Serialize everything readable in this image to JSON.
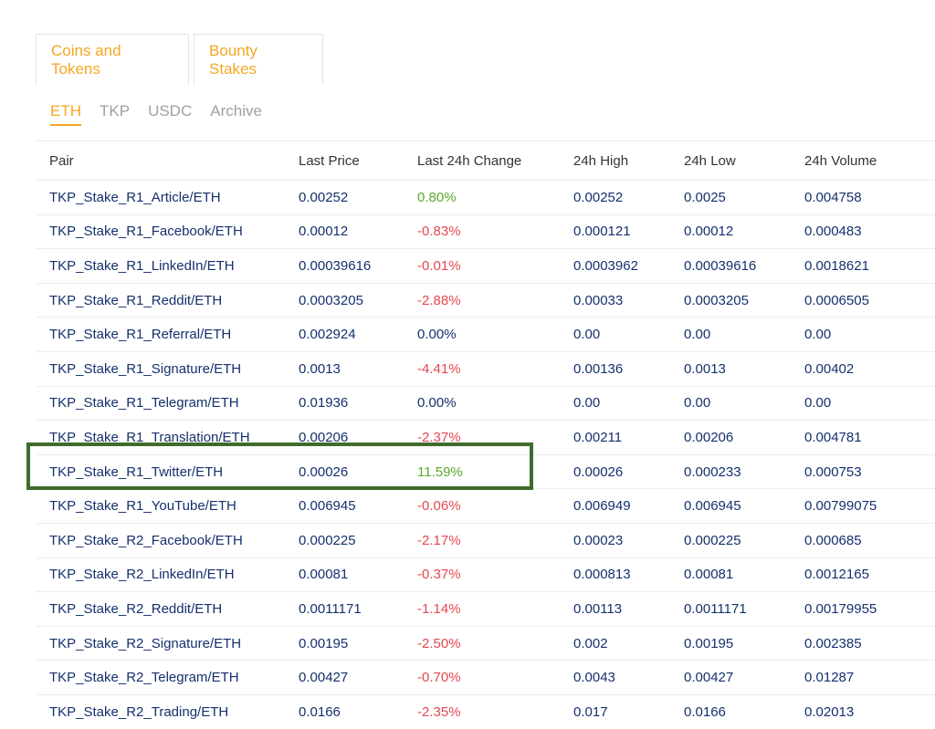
{
  "tabs": [
    "Coins and Tokens",
    "Bounty Stakes"
  ],
  "subtabs": [
    "ETH",
    "TKP",
    "USDC",
    "Archive"
  ],
  "table": {
    "headers": [
      "Pair",
      "Last Price",
      "Last 24h Change",
      "24h High",
      "24h Low",
      "24h Volume"
    ],
    "rows": [
      [
        "TKP_Stake_R1_Article/ETH",
        "0.00252",
        "0.80%",
        "0.00252",
        "0.0025",
        "0.004758"
      ],
      [
        "TKP_Stake_R1_Facebook/ETH",
        "0.00012",
        "-0.83%",
        "0.000121",
        "0.00012",
        "0.000483"
      ],
      [
        "TKP_Stake_R1_LinkedIn/ETH",
        "0.00039616",
        "-0.01%",
        "0.0003962",
        "0.00039616",
        "0.0018621"
      ],
      [
        "TKP_Stake_R1_Reddit/ETH",
        "0.0003205",
        "-2.88%",
        "0.00033",
        "0.0003205",
        "0.0006505"
      ],
      [
        "TKP_Stake_R1_Referral/ETH",
        "0.002924",
        "0.00%",
        "0.00",
        "0.00",
        "0.00"
      ],
      [
        "TKP_Stake_R1_Signature/ETH",
        "0.0013",
        "-4.41%",
        "0.00136",
        "0.0013",
        "0.00402"
      ],
      [
        "TKP_Stake_R1_Telegram/ETH",
        "0.01936",
        "0.00%",
        "0.00",
        "0.00",
        "0.00"
      ],
      [
        "TKP_Stake_R1_Translation/ETH",
        "0.00206",
        "-2.37%",
        "0.00211",
        "0.00206",
        "0.004781"
      ],
      [
        "TKP_Stake_R1_Twitter/ETH",
        "0.00026",
        "11.59%",
        "0.00026",
        "0.000233",
        "0.000753"
      ],
      [
        "TKP_Stake_R1_YouTube/ETH",
        "0.006945",
        "-0.06%",
        "0.006949",
        "0.006945",
        "0.00799075"
      ],
      [
        "TKP_Stake_R2_Facebook/ETH",
        "0.000225",
        "-2.17%",
        "0.00023",
        "0.000225",
        "0.000685"
      ],
      [
        "TKP_Stake_R2_LinkedIn/ETH",
        "0.00081",
        "-0.37%",
        "0.000813",
        "0.00081",
        "0.0012165"
      ],
      [
        "TKP_Stake_R2_Reddit/ETH",
        "0.0011171",
        "-1.14%",
        "0.00113",
        "0.0011171",
        "0.00179955"
      ],
      [
        "TKP_Stake_R2_Signature/ETH",
        "0.00195",
        "-2.50%",
        "0.002",
        "0.00195",
        "0.002385"
      ],
      [
        "TKP_Stake_R2_Telegram/ETH",
        "0.00427",
        "-0.70%",
        "0.0043",
        "0.00427",
        "0.01287"
      ],
      [
        "TKP_Stake_R2_Trading/ETH",
        "0.0166",
        "-2.35%",
        "0.017",
        "0.0166",
        "0.02013"
      ]
    ]
  },
  "colors": {
    "accent": "#f5a623",
    "link": "#15306d",
    "positive": "#5aa82a",
    "negative": "#e5474f",
    "highlight_border": "#3f6b2b"
  }
}
